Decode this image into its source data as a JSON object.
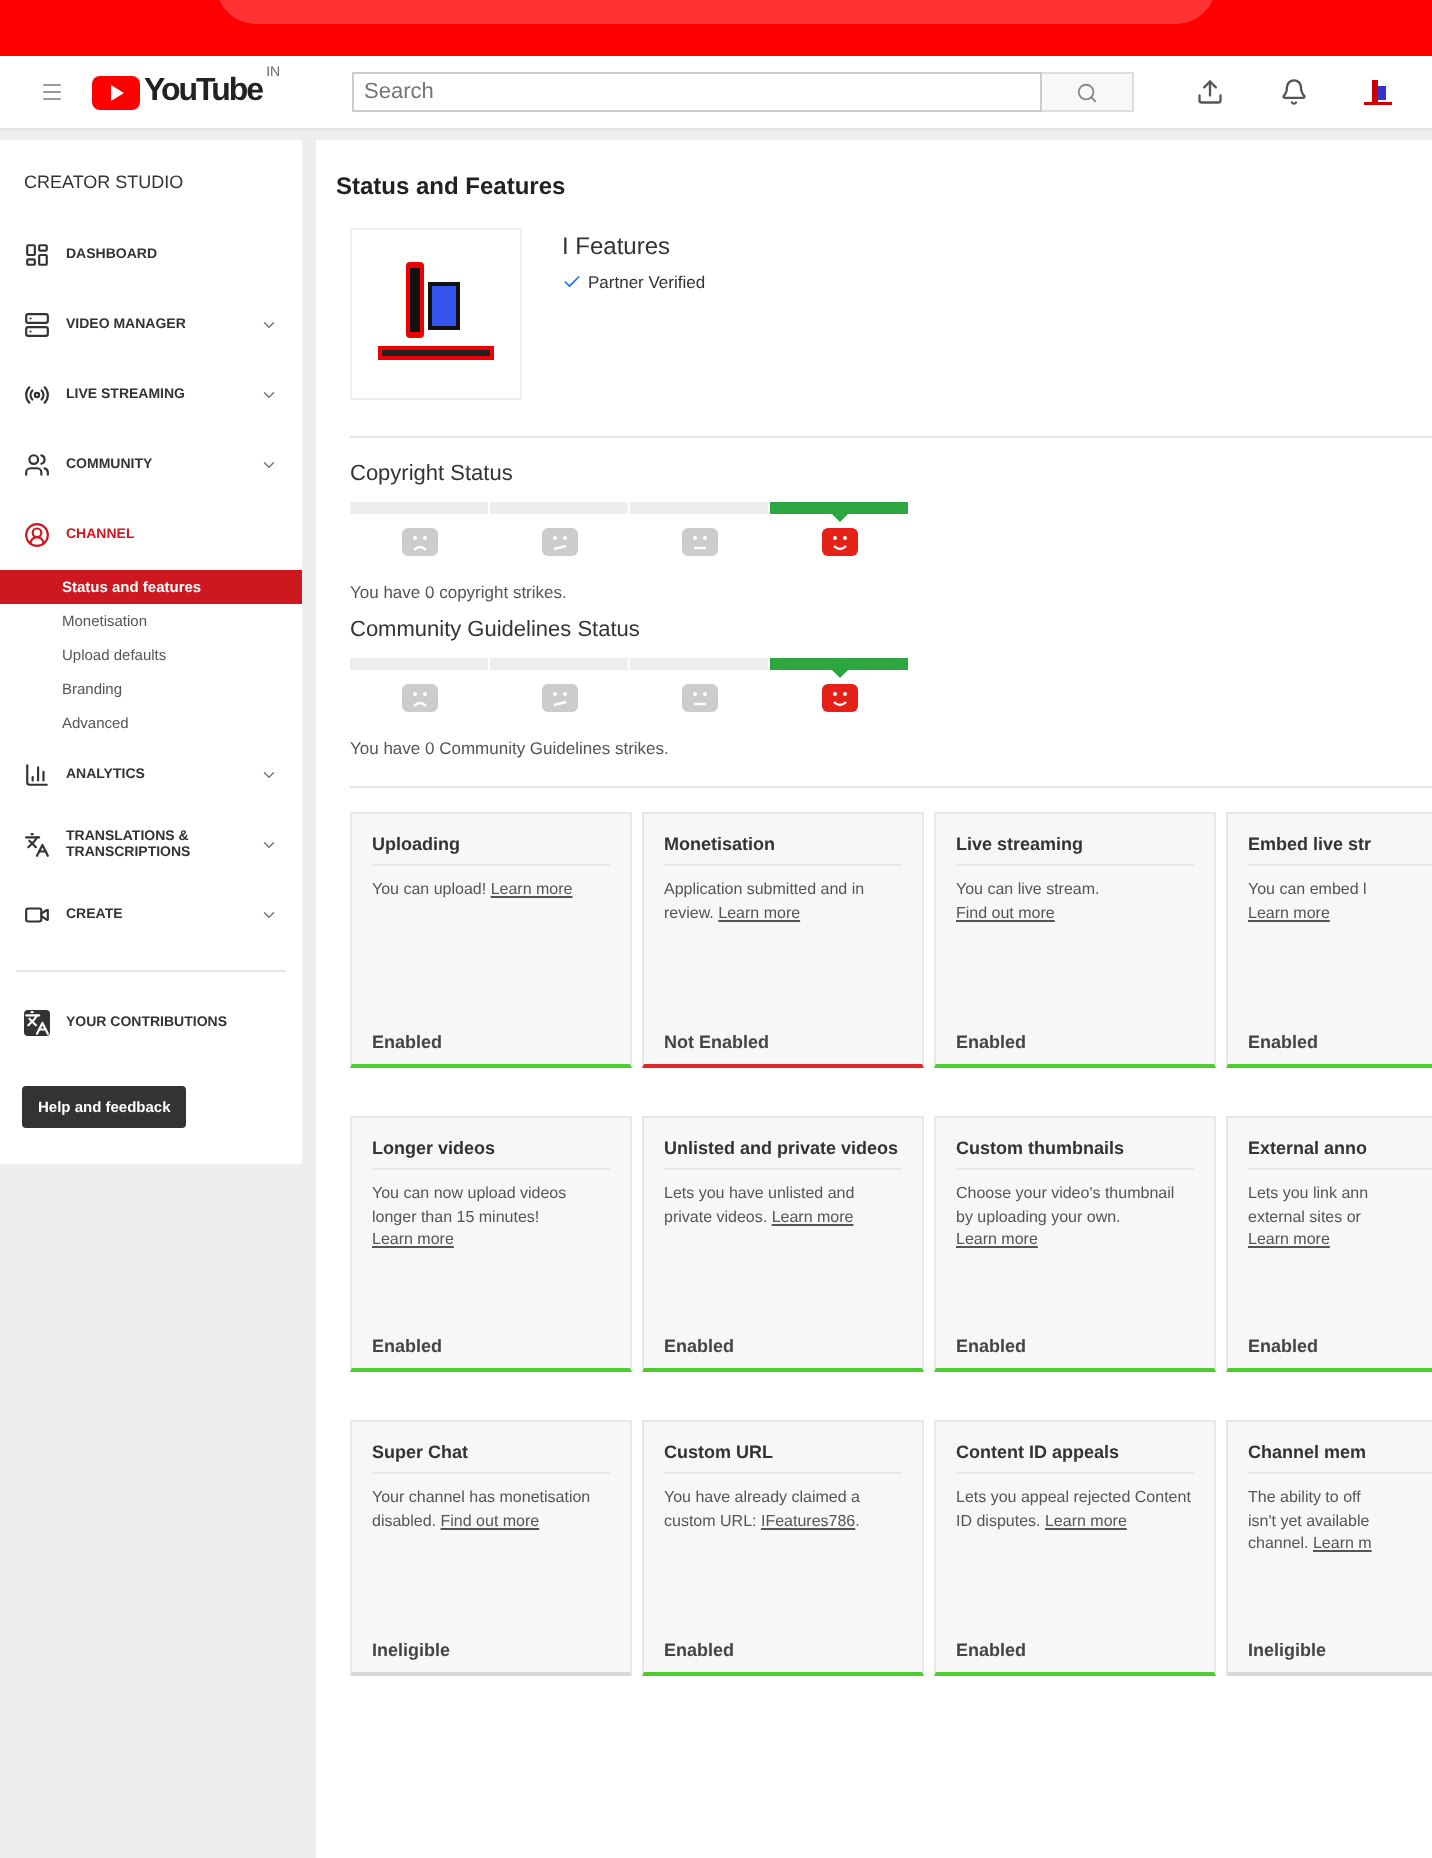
{
  "header": {
    "logo": "YouTube",
    "country": "IN",
    "search": {
      "placeholder": "Search"
    }
  },
  "sidebar": {
    "title": "CREATOR STUDIO",
    "items": [
      {
        "label": "DASHBOARD",
        "expandable": false,
        "selected": false
      },
      {
        "label": "VIDEO MANAGER",
        "expandable": true,
        "selected": false
      },
      {
        "label": "LIVE STREAMING",
        "expandable": true,
        "selected": false
      },
      {
        "label": "COMMUNITY",
        "expandable": true,
        "selected": false
      },
      {
        "label": "CHANNEL",
        "expandable": false,
        "selected": true,
        "children": [
          {
            "label": "Status and features",
            "selected": true
          },
          {
            "label": "Monetisation",
            "selected": false
          },
          {
            "label": "Upload defaults",
            "selected": false
          },
          {
            "label": "Branding",
            "selected": false
          },
          {
            "label": "Advanced",
            "selected": false
          }
        ]
      },
      {
        "label": "ANALYTICS",
        "expandable": true,
        "selected": false
      },
      {
        "label": "TRANSLATIONS & TRANSCRIPTIONS",
        "expandable": true,
        "selected": false
      },
      {
        "label": "CREATE",
        "expandable": true,
        "selected": false
      }
    ],
    "contributions": "YOUR CONTRIBUTIONS",
    "help_button": "Help and feedback"
  },
  "page_title": "Status and Features",
  "channel": {
    "name": "I Features",
    "badge": "Partner Verified"
  },
  "statuses": [
    {
      "title": "Copyright Status",
      "segments": [
        {
          "kind": "sad",
          "selected": false
        },
        {
          "kind": "unsure",
          "selected": false
        },
        {
          "kind": "neutral",
          "selected": false
        },
        {
          "kind": "happy",
          "selected": true
        }
      ],
      "text": "You have 0 copyright strikes."
    },
    {
      "title": "Community Guidelines Status",
      "segments": [
        {
          "kind": "sad",
          "selected": false
        },
        {
          "kind": "unsure",
          "selected": false
        },
        {
          "kind": "neutral",
          "selected": false
        },
        {
          "kind": "happy",
          "selected": true
        }
      ],
      "text": "You have 0 Community Guidelines strikes."
    }
  ],
  "features": [
    {
      "title": "Uploading",
      "text": "You can upload!",
      "link": "Learn more",
      "status": "Enabled",
      "kind": "enabled"
    },
    {
      "title": "Monetisation",
      "text": "Application submitted and in review.",
      "link": "Learn more",
      "status": "Not Enabled",
      "kind": "disabled"
    },
    {
      "title": "Live streaming",
      "text": "You can live stream.",
      "link": "Find out more",
      "status": "Enabled",
      "kind": "enabled"
    },
    {
      "title": "Embed live str",
      "lines": [
        "You can embed l"
      ],
      "link": "Learn more",
      "status": "Enabled",
      "kind": "enabled"
    },
    {
      "title": "Longer videos",
      "text": "You can now upload videos longer than 15 minutes!",
      "link": "Learn more",
      "status": "Enabled",
      "kind": "enabled"
    },
    {
      "title": "Unlisted and private videos",
      "text": "Lets you have unlisted and private videos.",
      "link": "Learn more",
      "status": "Enabled",
      "kind": "enabled"
    },
    {
      "title": "Custom thumbnails",
      "text": "Choose your video's thumbnail by uploading your own.",
      "link": "Learn more",
      "status": "Enabled",
      "kind": "enabled"
    },
    {
      "title": "External anno",
      "lines": [
        "Lets you link ann",
        "external sites or"
      ],
      "link": "Learn more",
      "status": "Enabled",
      "kind": "enabled"
    },
    {
      "title": "Super Chat",
      "text": "Your channel has monetisation disabled.",
      "link": "Find out more",
      "status": "Ineligible",
      "kind": "ineligible"
    },
    {
      "title": "Custom URL",
      "text": "You have already claimed a custom URL:",
      "link": "IFeatures786",
      "after": ".",
      "status": "Enabled",
      "kind": "enabled"
    },
    {
      "title": "Content ID appeals",
      "text": "Lets you appeal rejected Content ID disputes.",
      "link": "Learn more",
      "status": "Enabled",
      "kind": "enabled"
    },
    {
      "title": "Channel mem",
      "lines": [
        "The ability to off",
        "isn't yet available",
        "channel."
      ],
      "link": "Learn m",
      "status": "Ineligible",
      "kind": "ineligible"
    }
  ]
}
